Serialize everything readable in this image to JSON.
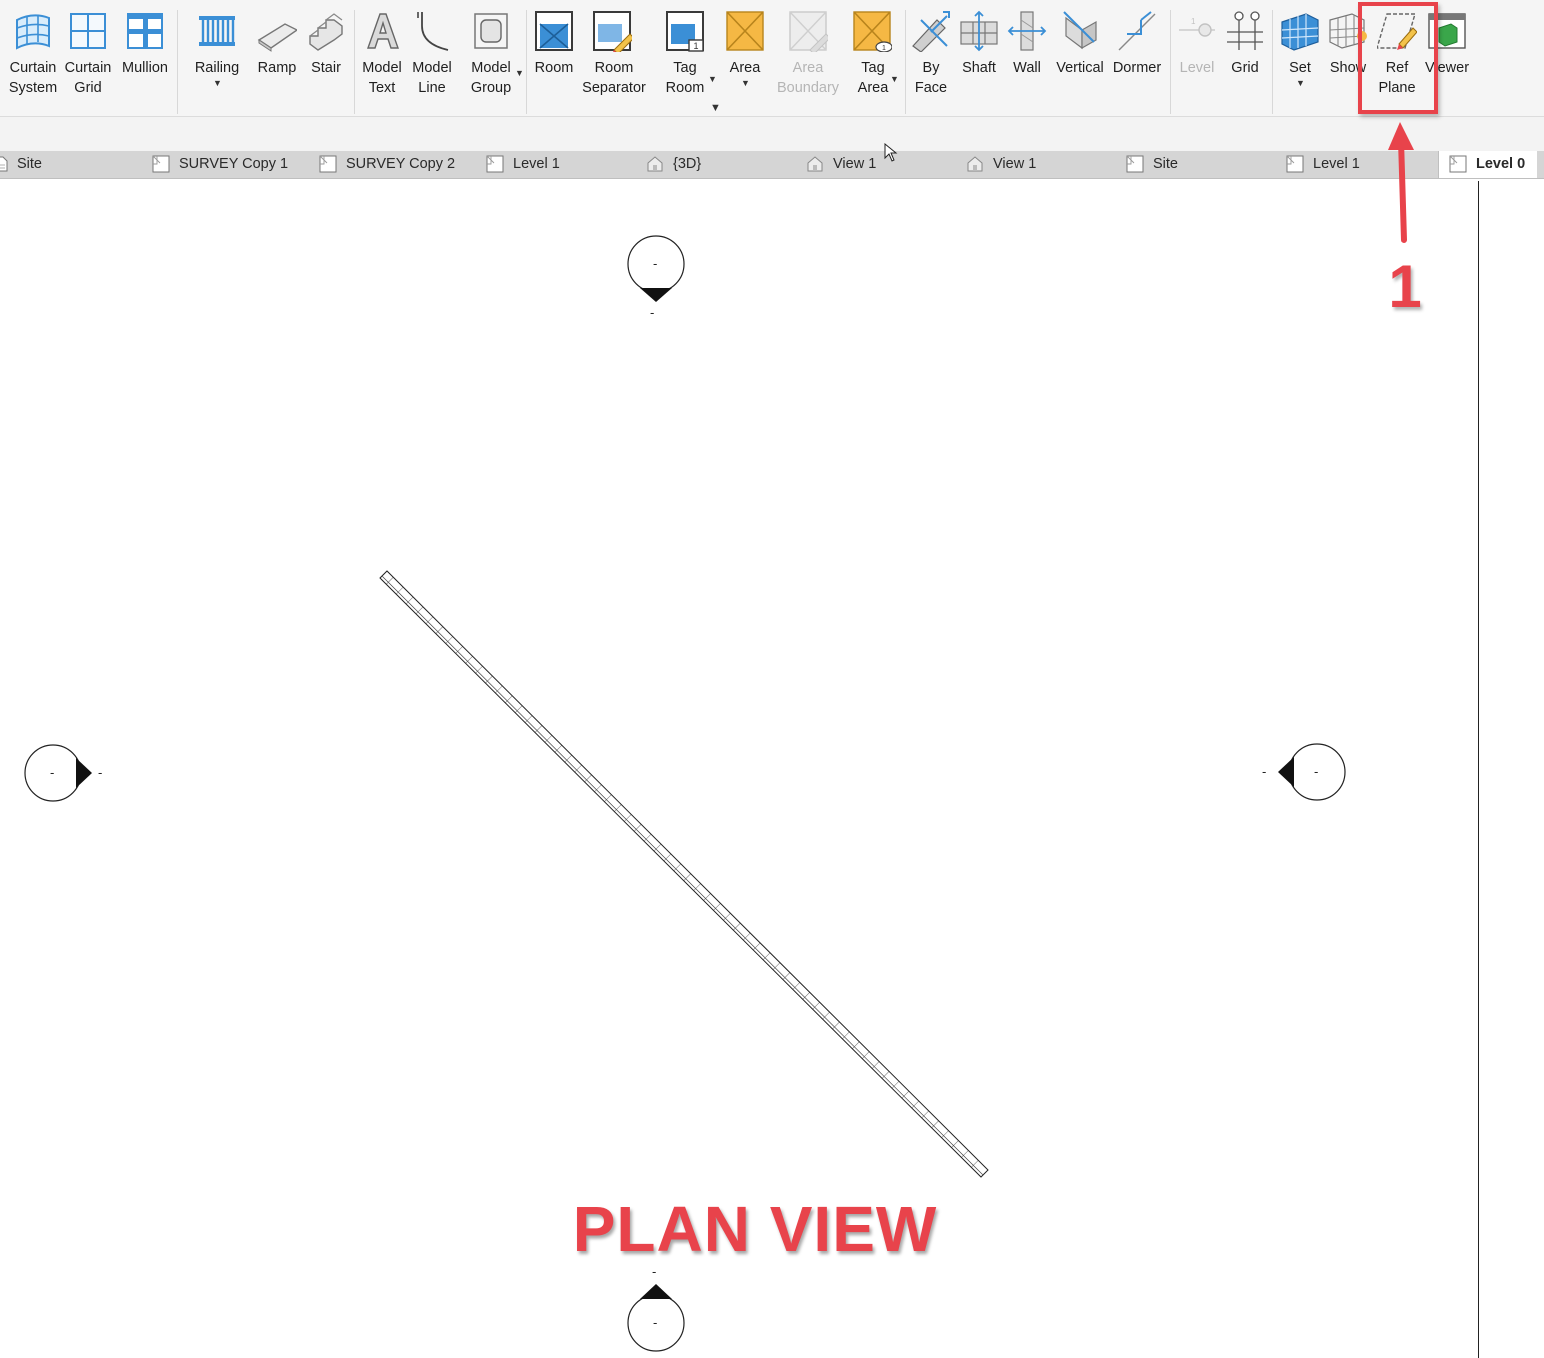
{
  "ribbon": {
    "tools": [
      {
        "id": "curtain-system",
        "label": "Curtain\nSystem",
        "icon": "curtain-system-icon"
      },
      {
        "id": "curtain-grid",
        "label": "Curtain\nGrid",
        "icon": "curtain-grid-icon"
      },
      {
        "id": "mullion",
        "label": "Mullion",
        "icon": "mullion-icon"
      },
      {
        "id": "railing",
        "label": "Railing",
        "icon": "railing-icon"
      },
      {
        "id": "ramp",
        "label": "Ramp",
        "icon": "ramp-icon"
      },
      {
        "id": "stair",
        "label": "Stair",
        "icon": "stair-icon"
      },
      {
        "id": "model-text",
        "label": "Model\nText",
        "icon": "model-text-icon"
      },
      {
        "id": "model-line",
        "label": "Model\nLine",
        "icon": "model-line-icon"
      },
      {
        "id": "model-group",
        "label": "Model\nGroup",
        "icon": "model-group-icon"
      },
      {
        "id": "room",
        "label": "Room",
        "icon": "room-icon"
      },
      {
        "id": "room-separator",
        "label": "Room\nSeparator",
        "icon": "room-separator-icon"
      },
      {
        "id": "tag-room",
        "label": "Tag\nRoom",
        "icon": "tag-room-icon"
      },
      {
        "id": "area",
        "label": "Area",
        "icon": "area-icon"
      },
      {
        "id": "area-boundary",
        "label": "Area\nBoundary",
        "icon": "area-boundary-icon"
      },
      {
        "id": "tag-area",
        "label": "Tag\nArea",
        "icon": "tag-area-icon"
      },
      {
        "id": "by-face",
        "label": "By\nFace",
        "icon": "by-face-icon"
      },
      {
        "id": "shaft",
        "label": "Shaft",
        "icon": "shaft-icon"
      },
      {
        "id": "wall",
        "label": "Wall",
        "icon": "wall-opening-icon"
      },
      {
        "id": "vertical",
        "label": "Vertical",
        "icon": "vertical-opening-icon"
      },
      {
        "id": "dormer",
        "label": "Dormer",
        "icon": "dormer-icon"
      },
      {
        "id": "level",
        "label": "Level",
        "icon": "level-icon"
      },
      {
        "id": "grid",
        "label": "Grid",
        "icon": "grid-icon"
      },
      {
        "id": "set",
        "label": "Set",
        "icon": "set-workplane-icon"
      },
      {
        "id": "show",
        "label": "Show",
        "icon": "show-workplane-icon"
      },
      {
        "id": "ref-plane",
        "label": "Ref\nPlane",
        "icon": "ref-plane-icon"
      },
      {
        "id": "viewer",
        "label": "Viewer",
        "icon": "viewer-icon"
      }
    ]
  },
  "view_tabs": [
    {
      "label": "Site",
      "icon": "plan-view-icon"
    },
    {
      "label": "SURVEY Copy 1",
      "icon": "plan-view-icon"
    },
    {
      "label": "SURVEY Copy 2",
      "icon": "plan-view-icon"
    },
    {
      "label": "Level 1",
      "icon": "plan-view-icon"
    },
    {
      "label": "{3D}",
      "icon": "3d-view-icon"
    },
    {
      "label": "View 1",
      "icon": "3d-view-icon"
    },
    {
      "label": "View 1",
      "icon": "3d-view-icon"
    },
    {
      "label": "Site",
      "icon": "plan-view-icon"
    },
    {
      "label": "Level 1",
      "icon": "plan-view-icon"
    },
    {
      "label": "Level 0",
      "icon": "plan-view-icon",
      "active": true
    }
  ],
  "canvas": {
    "elevation_marker_label": "-",
    "plan_title": "PLAN VIEW",
    "annotation_number": "1"
  },
  "colors": {
    "annotation": "#e8434b",
    "ribbon_bg": "#f5f5f5",
    "tab_bar_bg": "#d5d5d5",
    "icon_blue": "#3b8fd6",
    "icon_orange": "#f5b844"
  }
}
